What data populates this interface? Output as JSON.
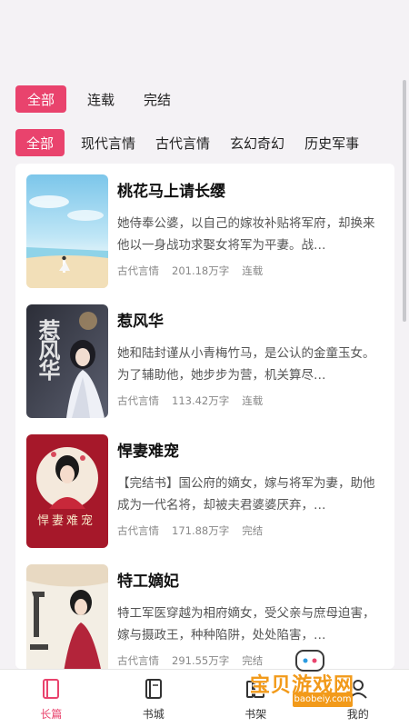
{
  "status_filters": [
    {
      "label": "全部",
      "active": true
    },
    {
      "label": "连载",
      "active": false
    },
    {
      "label": "完结",
      "active": false
    }
  ],
  "genre_filters": [
    {
      "label": "全部",
      "active": true
    },
    {
      "label": "现代言情",
      "active": false
    },
    {
      "label": "古代言情",
      "active": false
    },
    {
      "label": "玄幻奇幻",
      "active": false
    },
    {
      "label": "历史军事",
      "active": false
    }
  ],
  "books": [
    {
      "title": "桃花马上请长缨",
      "desc": "她侍奉公婆，以自己的嫁妆补贴将军府，却换来他以一身战功求娶女将军为平妻。战…",
      "genre": "古代言情",
      "words": "201.18万字",
      "status": "连载",
      "cover_theme": "sky"
    },
    {
      "title": "惹风华",
      "desc": "她和陆封谨从小青梅竹马，是公认的金童玉女。为了辅助他，她步步为营，机关算尽…",
      "genre": "古代言情",
      "words": "113.42万字",
      "status": "连载",
      "cover_theme": "dark"
    },
    {
      "title": "悍妻难宠",
      "desc": "【完结书】国公府的嫡女，嫁与将军为妻，助他成为一代名将，却被夫君婆婆厌弃，…",
      "genre": "古代言情",
      "words": "171.88万字",
      "status": "完结",
      "cover_theme": "red"
    },
    {
      "title": "特工嫡妃",
      "desc": "特工军医穿越为相府嫡女，受父亲与庶母迫害，嫁与摄政王，种种陷阱，处处陷害，…",
      "genre": "古代言情",
      "words": "291.55万字",
      "status": "完结",
      "cover_theme": "light"
    }
  ],
  "cover_text": {
    "book2": "惹风华",
    "book3": "悍妻难宠"
  },
  "tabbar": [
    {
      "label": "长篇",
      "icon": "book-icon",
      "active": true
    },
    {
      "label": "书城",
      "icon": "open-book-icon",
      "active": false
    },
    {
      "label": "书架",
      "icon": "bookshelf-icon",
      "active": false
    },
    {
      "label": "我的",
      "icon": "user-icon",
      "active": false
    }
  ],
  "watermark": {
    "text": "宝贝游戏网",
    "url": "baobeiy.com"
  },
  "colors": {
    "accent": "#e9436d",
    "background": "#f4f2f5",
    "watermark": "#f29a1a"
  }
}
